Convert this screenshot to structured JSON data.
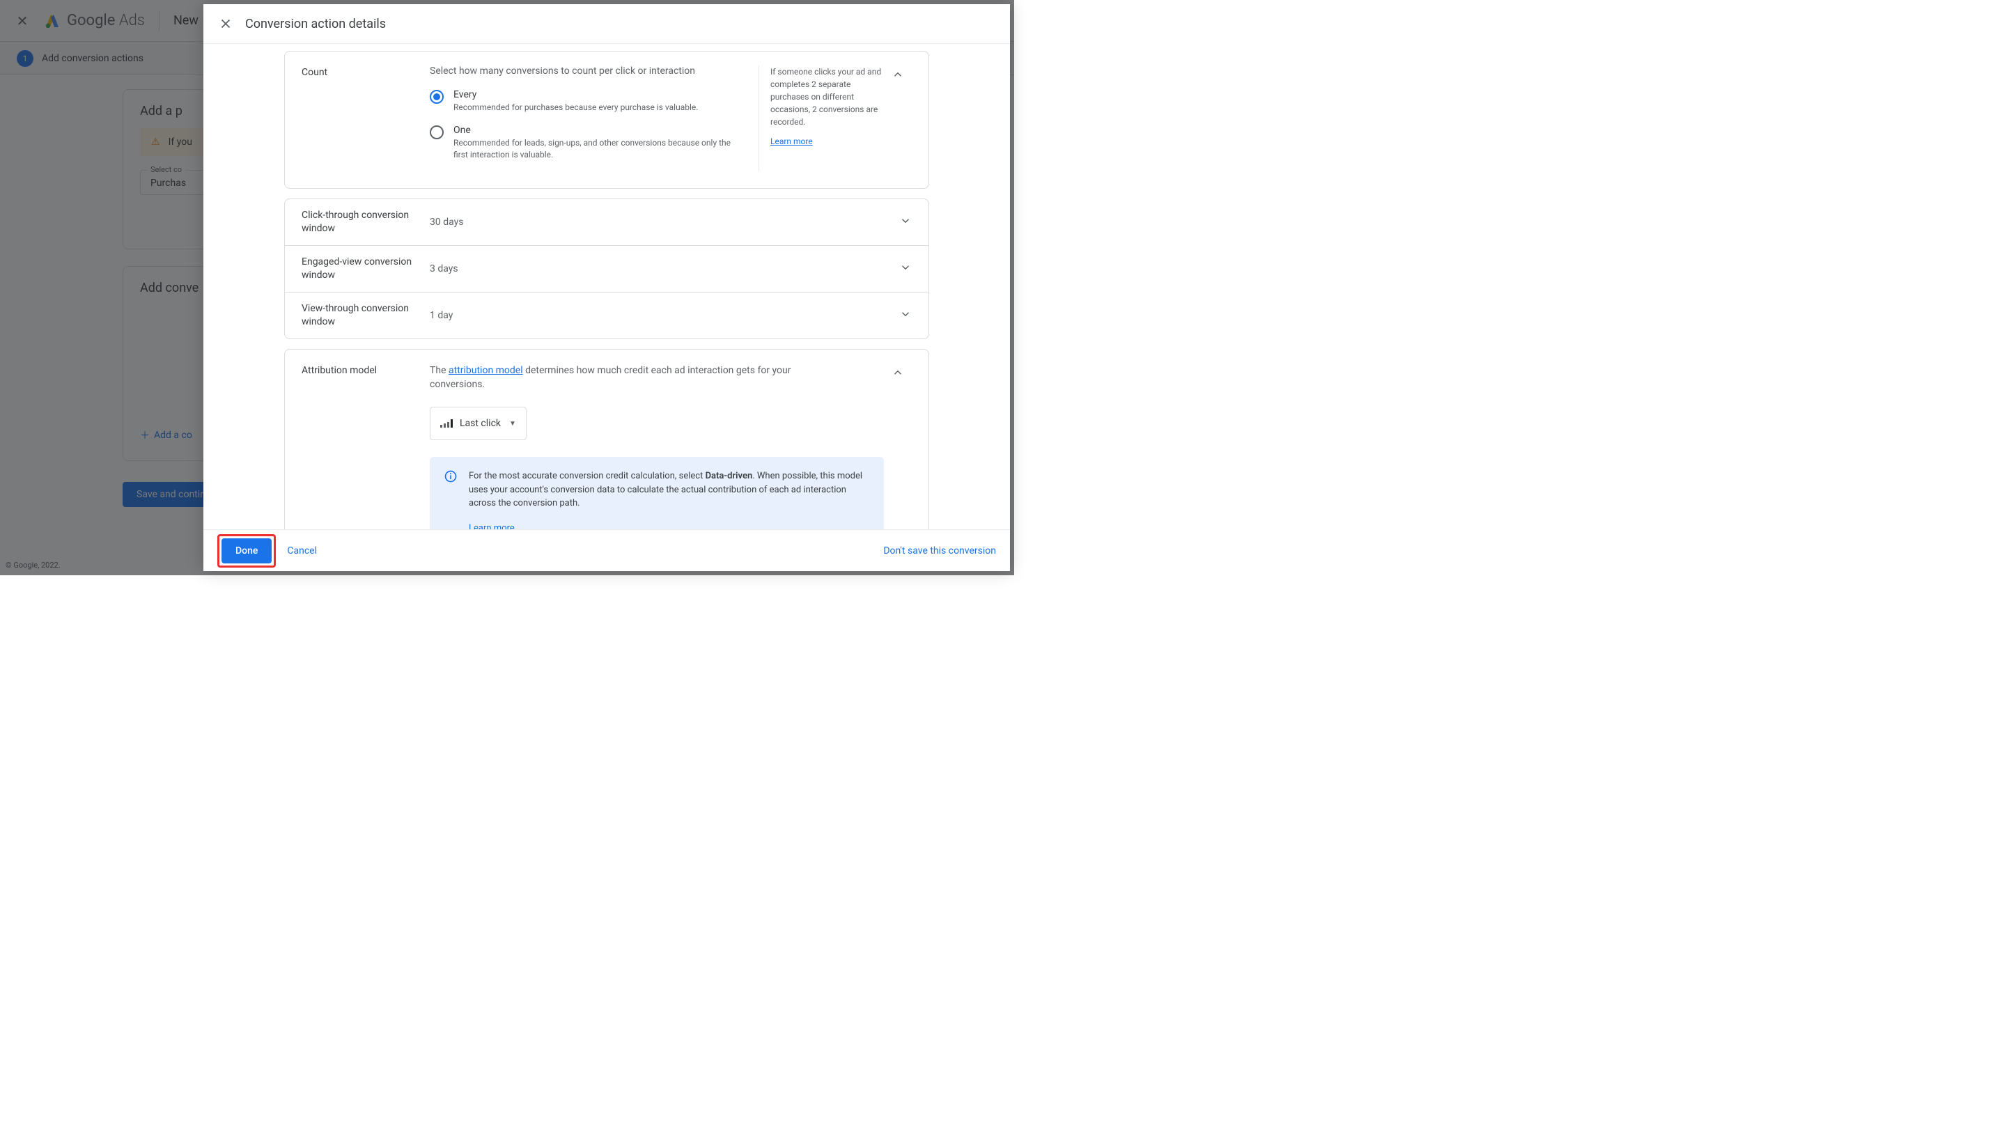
{
  "bg": {
    "logo_text1": "Google",
    "logo_text2": " Ads",
    "new_campaign": "New",
    "close_glyph": "✕",
    "step_number": "1",
    "step_label": "Add conversion actions",
    "card1_heading": "Add a p",
    "warn_text": "If you",
    "select_label": "Select co",
    "select_value": "Purchas",
    "card2_heading": "Add conve",
    "add_link": "Add a co",
    "save_btn": "Save and contin",
    "footer": "© Google, 2022."
  },
  "drawer": {
    "title": "Conversion action details",
    "count": {
      "label": "Count",
      "subhead": "Select how many conversions to count per click or interaction",
      "opt_every": {
        "label": "Every",
        "desc": "Recommended for purchases because every purchase is valuable."
      },
      "opt_one": {
        "label": "One",
        "desc": "Recommended for leads, sign-ups, and other conversions because only the first interaction is valuable."
      },
      "side_text": "If someone clicks your ad and completes 2 separate purchases on different occasions, 2 conversions are recorded.",
      "side_link": "Learn more"
    },
    "rows": {
      "click_window": {
        "label": "Click-through conversion window",
        "value": "30 days"
      },
      "engaged_window": {
        "label": "Engaged-view conversion window",
        "value": "3 days"
      },
      "view_window": {
        "label": "View-through conversion window",
        "value": "1 day"
      }
    },
    "attr": {
      "label": "Attribution model",
      "desc_pre": "The ",
      "desc_link": "attribution model",
      "desc_post": " determines how much credit each ad interaction gets for your conversions.",
      "select_value": "Last click",
      "info_pre": "For the most accurate conversion credit calculation, select ",
      "info_bold": "Data-driven",
      "info_post": ". When possible, this model uses your account's conversion data to calculate the actual contribution of each ad interaction across the conversion path.",
      "info_link": "Learn more"
    },
    "footer": {
      "done": "Done",
      "cancel": "Cancel",
      "dont_save": "Don't save this conversion"
    }
  }
}
